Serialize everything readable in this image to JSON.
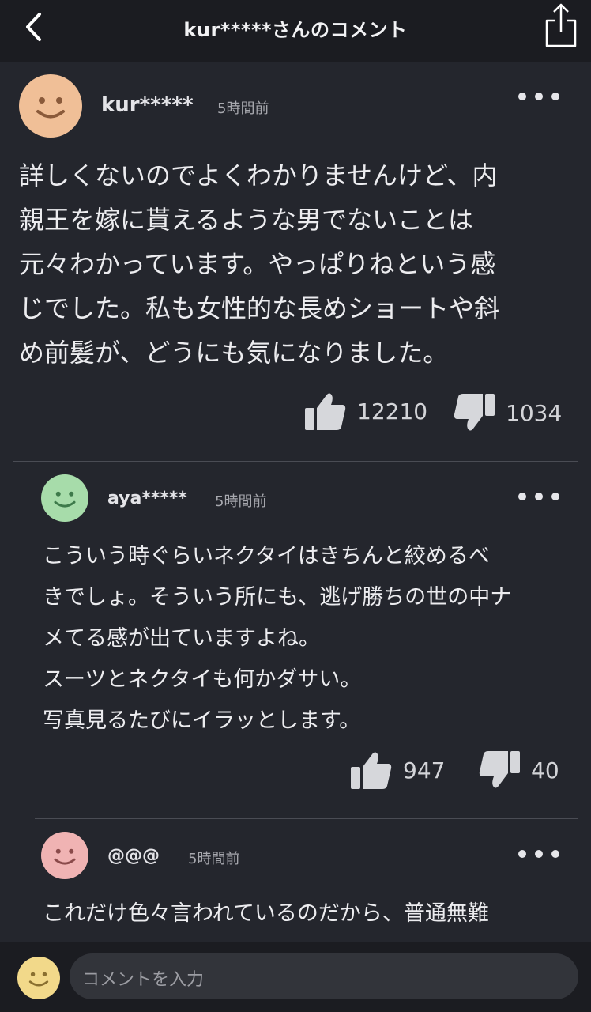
{
  "header": {
    "title": "kur*****さんのコメント"
  },
  "comments": [
    {
      "author": "kur*****",
      "time": "5時間前",
      "text": "詳しくないのでよくわかりませんけど、内\n親王を嫁に貰えるような男でないことは\n元々わかっています。やっぱりねという感\nじでした。私も女性的な長めショートや斜\nめ前髪が、どうにも気になりました。",
      "likes": "12210",
      "dislikes": "1034",
      "avatar_color": "#f0bf97"
    },
    {
      "author": "aya*****",
      "time": "5時間前",
      "text": "こういう時ぐらいネクタイはきちんと絞めるべ\nきでしょ。そういう所にも、逃げ勝ちの世の中ナ\nメてる感が出ていますよね。\nスーツとネクタイも何かダサい。\n写真見るたびにイラッとします。",
      "likes": "947",
      "dislikes": "40",
      "avatar_color": "#a7dcaa"
    },
    {
      "author": "@@@",
      "time": "5時間前",
      "text": "これだけ色々言われているのだから、普通無難\nな無難で行きませんか？",
      "avatar_color": "#f0b3b3"
    }
  ],
  "composer": {
    "placeholder": "コメントを入力",
    "avatar_color": "#f2d98a"
  },
  "icons": [
    "back-chevron-icon",
    "share-icon",
    "more-dots-icon",
    "thumbs-up-icon",
    "thumbs-down-icon",
    "smiley-avatar-icon"
  ]
}
